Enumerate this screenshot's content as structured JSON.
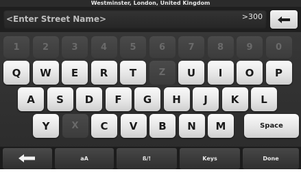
{
  "header": {
    "location": "Westminster, London, United Kingdom"
  },
  "search": {
    "placeholder": "<Enter Street Name>",
    "result_count": ">300"
  },
  "keyboard": {
    "number_row": [
      "1",
      "2",
      "3",
      "4",
      "5",
      "6",
      "7",
      "8",
      "9",
      "0"
    ],
    "row1": [
      "Q",
      "W",
      "E",
      "R",
      "T",
      "Z",
      "U",
      "I",
      "O",
      "P"
    ],
    "row1_disabled": [
      false,
      false,
      false,
      false,
      false,
      true,
      false,
      false,
      false,
      false
    ],
    "row2": [
      "A",
      "S",
      "D",
      "F",
      "G",
      "H",
      "J",
      "K",
      "L"
    ],
    "row3": [
      "Y",
      "X",
      "C",
      "V",
      "B",
      "N",
      "M"
    ],
    "row3_disabled": [
      false,
      true,
      false,
      false,
      false,
      false,
      false
    ],
    "space_label": "Space"
  },
  "bottom_bar": {
    "case_label": "aA",
    "alphabet_label": "ß/!",
    "keys_label": "Keys",
    "done_label": "Done"
  },
  "icons": {
    "backspace": "left-arrow-icon",
    "back": "back-arrow-icon"
  },
  "colors": {
    "active_key": "#e6e6e6",
    "disabled_key": "#444444",
    "background": "#2e2e2e"
  }
}
